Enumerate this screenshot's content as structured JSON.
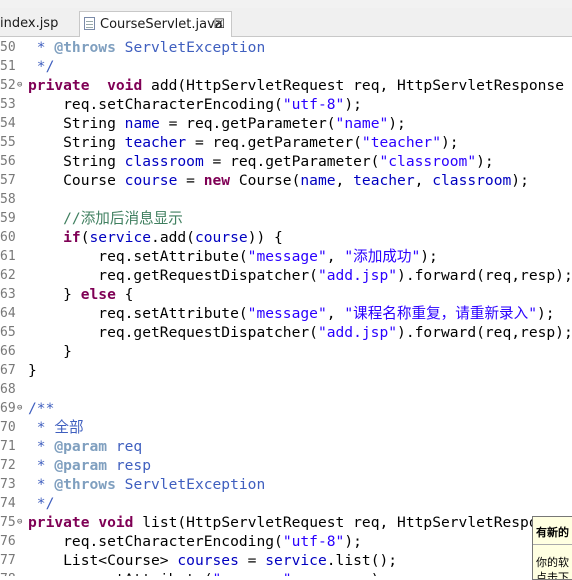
{
  "tabs": [
    {
      "label": "index.jsp",
      "active": false
    },
    {
      "label": "CourseServlet.java",
      "active": true,
      "close": "☒"
    }
  ],
  "editor": {
    "lines": [
      {
        "num": "50",
        "fold": "",
        "tokens": [
          [
            "jd",
            " * "
          ],
          [
            "jdt",
            "@throws"
          ],
          [
            "jd",
            " ServletException"
          ]
        ]
      },
      {
        "num": "51",
        "fold": "",
        "tokens": [
          [
            "jd",
            " */"
          ]
        ]
      },
      {
        "num": "52",
        "fold": "⊖",
        "tokens": [
          [
            "kw",
            "private"
          ],
          [
            "",
            "  "
          ],
          [
            "kw",
            "void"
          ],
          [
            "",
            " add(HttpServletRequest req, HttpServletResponse resp) "
          ]
        ]
      },
      {
        "num": "53",
        "fold": "",
        "tokens": [
          [
            "",
            "    req.setCharacterEncoding("
          ],
          [
            "str",
            "\"utf-8\""
          ],
          [
            "",
            ");"
          ]
        ]
      },
      {
        "num": "54",
        "fold": "",
        "tokens": [
          [
            "",
            "    String "
          ],
          [
            "fld",
            "name"
          ],
          [
            "",
            " = req.getParameter("
          ],
          [
            "str",
            "\"name\""
          ],
          [
            "",
            ");"
          ]
        ]
      },
      {
        "num": "55",
        "fold": "",
        "tokens": [
          [
            "",
            "    String "
          ],
          [
            "fld",
            "teacher"
          ],
          [
            "",
            " = req.getParameter("
          ],
          [
            "str",
            "\"teacher\""
          ],
          [
            "",
            ");"
          ]
        ]
      },
      {
        "num": "56",
        "fold": "",
        "tokens": [
          [
            "",
            "    String "
          ],
          [
            "fld",
            "classroom"
          ],
          [
            "",
            " = req.getParameter("
          ],
          [
            "str",
            "\"classroom\""
          ],
          [
            "",
            ");"
          ]
        ]
      },
      {
        "num": "57",
        "fold": "",
        "tokens": [
          [
            "",
            "    Course "
          ],
          [
            "fld",
            "course"
          ],
          [
            "",
            " = "
          ],
          [
            "kw",
            "new"
          ],
          [
            "",
            " Course("
          ],
          [
            "fld",
            "name"
          ],
          [
            "",
            ", "
          ],
          [
            "fld",
            "teacher"
          ],
          [
            "",
            ", "
          ],
          [
            "fld",
            "classroom"
          ],
          [
            "",
            ");"
          ]
        ]
      },
      {
        "num": "58",
        "fold": "",
        "tokens": []
      },
      {
        "num": "59",
        "fold": "",
        "tokens": [
          [
            "cmt",
            "    //添加后消息显示"
          ]
        ]
      },
      {
        "num": "60",
        "fold": "",
        "tokens": [
          [
            "kw",
            "    if"
          ],
          [
            "",
            "("
          ],
          [
            "fld",
            "service"
          ],
          [
            "",
            ".add("
          ],
          [
            "fld",
            "course"
          ],
          [
            "",
            ")) {"
          ]
        ]
      },
      {
        "num": "61",
        "fold": "",
        "tokens": [
          [
            "",
            "        req.setAttribute("
          ],
          [
            "str",
            "\"message\""
          ],
          [
            "",
            ", "
          ],
          [
            "str",
            "\"添加成功\""
          ],
          [
            "",
            ");"
          ]
        ]
      },
      {
        "num": "62",
        "fold": "",
        "tokens": [
          [
            "",
            "        req.getRequestDispatcher("
          ],
          [
            "str",
            "\"add.jsp\""
          ],
          [
            "",
            ").forward(req,resp);"
          ]
        ]
      },
      {
        "num": "63",
        "fold": "",
        "tokens": [
          [
            "",
            "    } "
          ],
          [
            "kw",
            "else"
          ],
          [
            "",
            " {"
          ]
        ]
      },
      {
        "num": "64",
        "fold": "",
        "tokens": [
          [
            "",
            "        req.setAttribute("
          ],
          [
            "str",
            "\"message\""
          ],
          [
            "",
            ", "
          ],
          [
            "str",
            "\"课程名称重复，请重新录入\""
          ],
          [
            "",
            ");"
          ]
        ]
      },
      {
        "num": "65",
        "fold": "",
        "tokens": [
          [
            "",
            "        req.getRequestDispatcher("
          ],
          [
            "str",
            "\"add.jsp\""
          ],
          [
            "",
            ").forward(req,resp);"
          ]
        ]
      },
      {
        "num": "66",
        "fold": "",
        "tokens": [
          [
            "",
            "    }"
          ]
        ]
      },
      {
        "num": "67",
        "fold": "",
        "tokens": [
          [
            "",
            "}"
          ]
        ]
      },
      {
        "num": "68",
        "fold": "",
        "tokens": []
      },
      {
        "num": "69",
        "fold": "⊖",
        "tokens": [
          [
            "jd",
            "/**"
          ]
        ]
      },
      {
        "num": "70",
        "fold": "",
        "tokens": [
          [
            "jd",
            " * 全部"
          ]
        ]
      },
      {
        "num": "71",
        "fold": "",
        "tokens": [
          [
            "jd",
            " * "
          ],
          [
            "jdt",
            "@param"
          ],
          [
            "jd",
            " req"
          ]
        ]
      },
      {
        "num": "72",
        "fold": "",
        "tokens": [
          [
            "jd",
            " * "
          ],
          [
            "jdt",
            "@param"
          ],
          [
            "jd",
            " resp"
          ]
        ]
      },
      {
        "num": "73",
        "fold": "",
        "tokens": [
          [
            "jd",
            " * "
          ],
          [
            "jdt",
            "@throws"
          ],
          [
            "jd",
            " ServletException"
          ]
        ]
      },
      {
        "num": "74",
        "fold": "",
        "tokens": [
          [
            "jd",
            " */"
          ]
        ]
      },
      {
        "num": "75",
        "fold": "⊖",
        "tokens": [
          [
            "kw",
            "private"
          ],
          [
            "",
            " "
          ],
          [
            "kw",
            "void"
          ],
          [
            "",
            " list(HttpServletRequest req, HttpServletResponse resp)"
          ]
        ]
      },
      {
        "num": "76",
        "fold": "",
        "tokens": [
          [
            "",
            "    req.setCharacterEncoding("
          ],
          [
            "str",
            "\"utf-8\""
          ],
          [
            "",
            ");"
          ]
        ]
      },
      {
        "num": "77",
        "fold": "",
        "tokens": [
          [
            "",
            "    List<Course> "
          ],
          [
            "fld",
            "courses"
          ],
          [
            "",
            " = "
          ],
          [
            "fld",
            "service"
          ],
          [
            "",
            ".list();"
          ]
        ]
      },
      {
        "num": "78",
        "fold": "",
        "tokens": [
          [
            "",
            "    req.setAttribute("
          ],
          [
            "str",
            "\"courses\""
          ],
          [
            "",
            ", "
          ],
          [
            "fld",
            "courses"
          ],
          [
            "",
            ");"
          ]
        ]
      }
    ]
  },
  "tooltip": {
    "title": "有新的",
    "body1": "你的软",
    "body2": "点击下"
  }
}
